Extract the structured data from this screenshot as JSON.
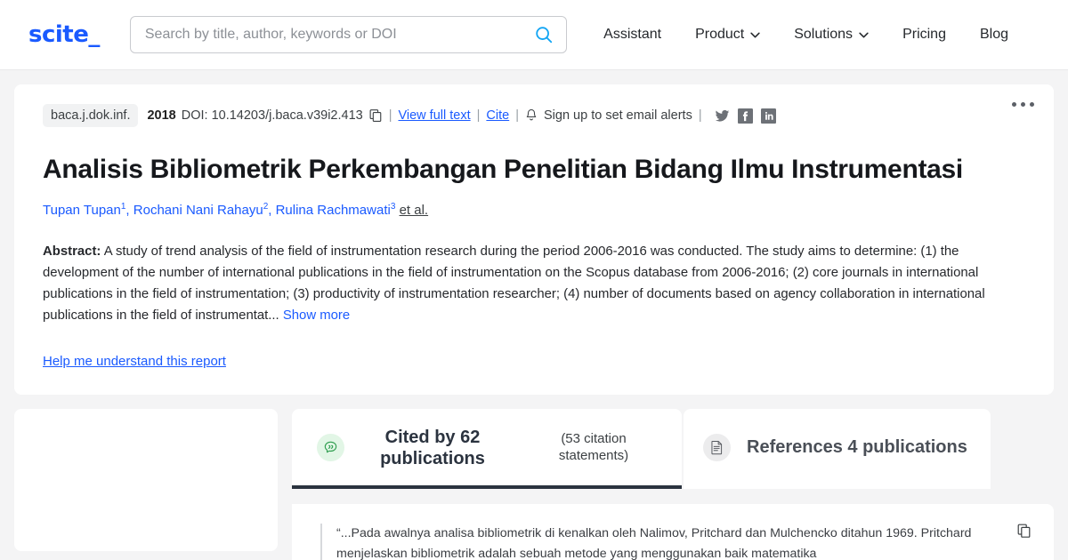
{
  "header": {
    "logo": "scite_",
    "search": {
      "placeholder": "Search by title, author, keywords or DOI",
      "value": "",
      "icon": "search-icon"
    },
    "nav": [
      {
        "label": "Assistant",
        "has_caret": false
      },
      {
        "label": "Product",
        "has_caret": true
      },
      {
        "label": "Solutions",
        "has_caret": true
      },
      {
        "label": "Pricing",
        "has_caret": false
      },
      {
        "label": "Blog",
        "has_caret": false
      }
    ]
  },
  "paper": {
    "journal_badge": "baca.j.dok.inf.",
    "year": "2018",
    "doi": "DOI: 10.14203/j.baca.v39i2.413",
    "copy_doi_icon": "copy-icon",
    "view_full_text": "View full text",
    "cite": "Cite",
    "bell_icon": "bell-icon",
    "email_alerts": "Sign up to set email alerts",
    "separator": "|",
    "socials": [
      "twitter-icon",
      "facebook-icon",
      "linkedin-icon"
    ],
    "more_menu": "more-options-icon",
    "title": "Analisis Bibliometrik Perkembangan Penelitian Bidang Ilmu Instrumentasi",
    "authors": [
      {
        "name": "Tupan Tupan",
        "sup": "1"
      },
      {
        "name": "Rochani Nani Rahayu",
        "sup": "2"
      },
      {
        "name": "Rulina Rachmawati",
        "sup": "3"
      }
    ],
    "et_al": "et al.",
    "abstract_label": "Abstract:",
    "abstract_body": "A study of trend analysis of the field of instrumentation research during the period 2006-2016 was conducted. The study aims to determine: (1) the development of the number of international publications in the field of instrumentation on the Scopus database from 2006-2016; (2) core journals in international publications in the field of instrumentation; (3) productivity of instrumentation researcher; (4) number of documents based on agency collaboration in international publications in the field of instrumentat...",
    "show_more": "Show more",
    "help_link": "Help me understand this report"
  },
  "tabs": {
    "cited_by": {
      "icon": "quote-bubble-icon",
      "title": "Cited by 62 publications",
      "subtitle": "(53 citation statements)",
      "active": true
    },
    "references": {
      "icon": "document-icon",
      "title": "References 4 publications",
      "active": false
    }
  },
  "citation_statement": {
    "text": "“...Pada awalnya analisa bibliometrik di kenalkan oleh Nalimov, Pritchard dan Mulchencko ditahun 1969. Pritchard menjelaskan bibliometrik adalah sebuah metode yang menggunakan baik matematika",
    "copy_icon": "copy-icon"
  },
  "colors": {
    "brand_blue": "#1a5aff",
    "search_icon_cyan": "#12a5f4",
    "active_tab_underline": "#2b333f",
    "page_bg": "#f4f4f5",
    "green_badge_bg": "#e2f6e6",
    "green_icon": "#2f9e4f"
  }
}
